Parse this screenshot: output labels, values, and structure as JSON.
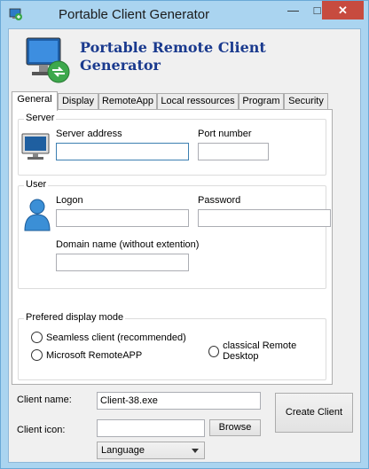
{
  "window": {
    "title": "Portable Client Generator",
    "controls": {
      "minimize": "—",
      "maximize": "□",
      "close": "✕"
    }
  },
  "banner": {
    "line1": "Portable Remote Client",
    "line2": "Generator"
  },
  "tabs": [
    {
      "label": "General",
      "active": true
    },
    {
      "label": "Display"
    },
    {
      "label": "RemoteApp"
    },
    {
      "label": "Local ressources"
    },
    {
      "label": "Program"
    },
    {
      "label": "Security"
    }
  ],
  "server": {
    "group_label": "Server",
    "address_label": "Server address",
    "address_value": "",
    "port_label": "Port number",
    "port_value": ""
  },
  "user": {
    "group_label": "User",
    "logon_label": "Logon",
    "logon_value": "",
    "password_label": "Password",
    "password_value": "",
    "domain_label": "Domain name (without extention)",
    "domain_value": ""
  },
  "display_mode": {
    "group_label": "Prefered display mode",
    "options": [
      "Seamless client (recommended)",
      "Microsoft RemoteAPP",
      "classical Remote Desktop"
    ]
  },
  "bottom": {
    "client_name_label": "Client name:",
    "client_name_value": "Client-38.exe",
    "client_icon_label": "Client icon:",
    "client_icon_value": "",
    "browse_label": "Browse",
    "language_value": "Language",
    "create_label": "Create Client"
  },
  "colors": {
    "title_accent": "#1a3a8e",
    "window_frame": "#aad4f0",
    "close_button": "#c74b3f"
  }
}
